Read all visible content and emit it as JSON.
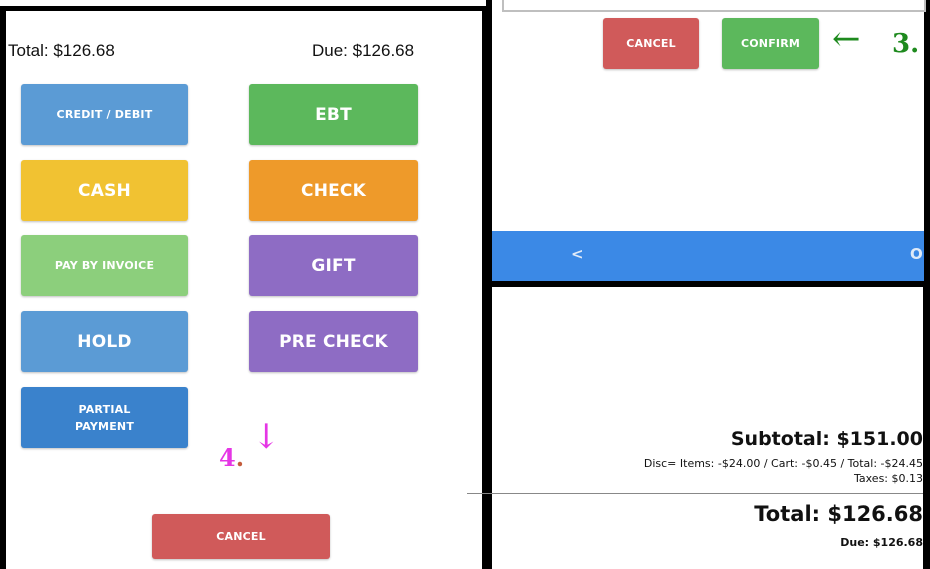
{
  "payment": {
    "total_label": "Total: $126.68",
    "due_label": "Due: $126.68",
    "buttons": {
      "credit_debit": "CREDIT / DEBIT",
      "ebt": "EBT",
      "cash": "CASH",
      "check": "CHECK",
      "pay_by_invoice": "PAY BY INVOICE",
      "gift": "GIFT",
      "hold": "HOLD",
      "pre_check": "PRE CHECK",
      "partial_payment_line1": "PARTIAL",
      "partial_payment_line2": "PAYMENT",
      "cancel": "CANCEL"
    }
  },
  "dialog": {
    "cancel_label": "CANCEL",
    "confirm_label": "CONFIRM",
    "back_glyph": "<",
    "other_glyph": "O"
  },
  "annotations": {
    "step3_arrow": "←",
    "step3_label": "3.",
    "step4_label": "4",
    "step4_dot": ".",
    "step4_arrow": "↓"
  },
  "summary": {
    "subtotal": "Subtotal: $151.00",
    "discounts": "Disc= Items: -$24.00 / Cart: -$0.45 / Total: -$24.45",
    "taxes": "Taxes: $0.13",
    "total": "Total: $126.68",
    "due": "Due: $126.68"
  },
  "colors": {
    "annotation_green": "#1e8a1e",
    "annotation_magenta": "#e536e5",
    "bar_blue": "#3b89e6"
  }
}
